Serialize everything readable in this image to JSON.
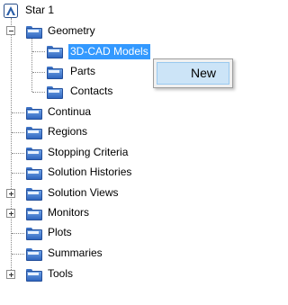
{
  "tree": {
    "root_label": "Star 1",
    "geometry": {
      "label": "Geometry",
      "children": [
        "3D-CAD Models",
        "Parts",
        "Contacts"
      ]
    },
    "items": [
      "Continua",
      "Regions",
      "Stopping Criteria",
      "Solution Histories",
      "Solution Views",
      "Monitors",
      "Plots",
      "Summaries",
      "Tools"
    ]
  },
  "context_menu": {
    "new_label": "New"
  },
  "colors": {
    "selection": "#3399ff",
    "folder": "#3f78cf",
    "menu_highlight": "#cce4f7"
  },
  "icons": {
    "root": "app-icon",
    "folder": "folder-icon",
    "expand": "plus-box-icon",
    "collapse": "minus-box-icon"
  }
}
